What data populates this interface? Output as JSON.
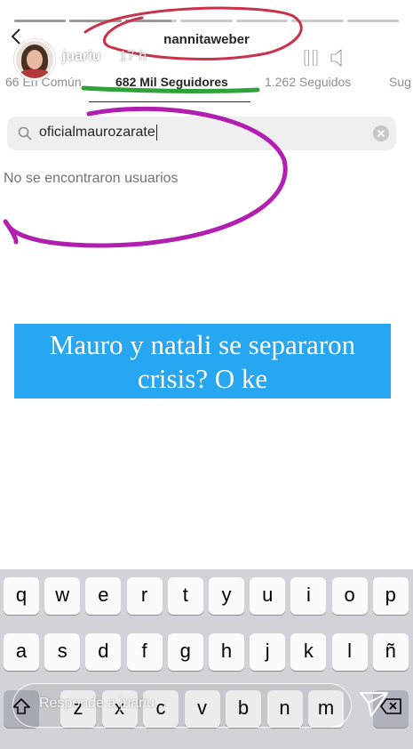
{
  "story": {
    "poster": "juariu",
    "time": "17 h",
    "reply_placeholder": "Responde a juariu...",
    "progress": [
      1,
      1,
      0.9,
      0,
      0,
      0,
      0
    ]
  },
  "screenshot": {
    "username": "nannitaweber",
    "tabs": [
      {
        "label": "66 En Común",
        "active": false
      },
      {
        "label": "682 Mil Seguidores",
        "active": true
      },
      {
        "label": "1.262 Seguidos",
        "active": false
      },
      {
        "label": "Sug",
        "active": false
      }
    ],
    "search": {
      "value": "oficialmaurozarate"
    },
    "no_results": "No se encontraron usuarios"
  },
  "caption": {
    "line1": "Mauro y natali se separaron",
    "line2": "crisis? O ke"
  },
  "keyboard": {
    "row1": [
      "q",
      "w",
      "e",
      "r",
      "t",
      "y",
      "u",
      "i",
      "o",
      "p"
    ],
    "row2": [
      "a",
      "s",
      "d",
      "f",
      "g",
      "h",
      "j",
      "k",
      "l",
      "ñ"
    ],
    "row3": [
      "z",
      "x",
      "c",
      "v",
      "b",
      "n",
      "m"
    ]
  },
  "colors": {
    "caption_bg": "#27a7f2",
    "annotation_red": "#c8324a",
    "annotation_purple": "#b21fb0",
    "annotation_green": "#2fa33a"
  }
}
